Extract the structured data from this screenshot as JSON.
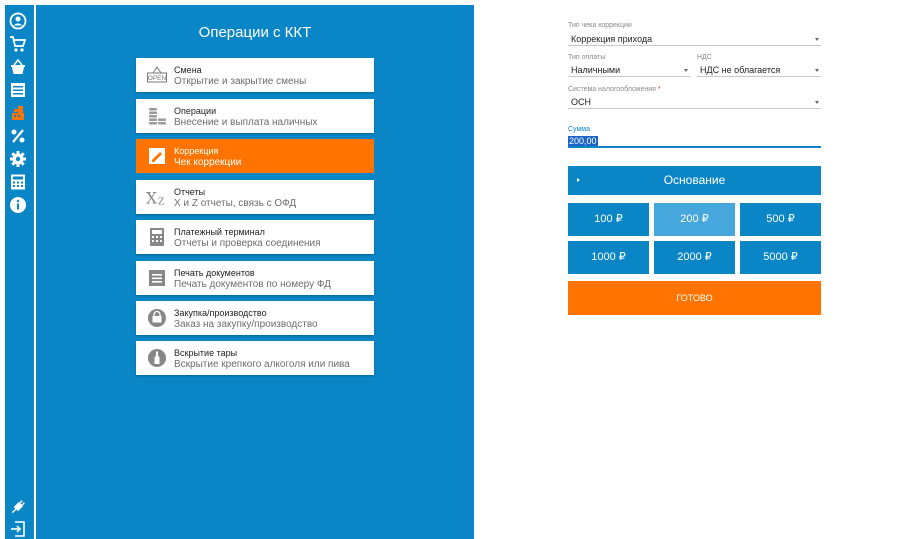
{
  "sidebar": {
    "icons": [
      "user-circle-icon",
      "cart-icon",
      "basket-icon",
      "list-icon",
      "cash-register-icon",
      "percent-icon",
      "gear-icon",
      "calculator-icon",
      "info-icon",
      "plug-icon",
      "logout-icon"
    ],
    "active_icon": "cash-register-icon"
  },
  "panel": {
    "title": "Операции с ККТ",
    "items": [
      {
        "title": "Смена",
        "subtitle": "Открытие и закрытие смены",
        "icon": "open-sign-icon"
      },
      {
        "title": "Операции",
        "subtitle": "Внесение и выплата наличных",
        "icon": "coins-icon"
      },
      {
        "title": "Коррекция",
        "subtitle": "Чек коррекции",
        "icon": "correction-icon",
        "active": true
      },
      {
        "title": "Отчеты",
        "subtitle": "X и Z отчеты, связь с ОФД",
        "icon": "xz-icon"
      },
      {
        "title": "Платежный терминал",
        "subtitle": "Отчеты и проверка соединения",
        "icon": "terminal-icon"
      },
      {
        "title": "Печать документов",
        "subtitle": "Печать документов по номеру ФД",
        "icon": "document-icon"
      },
      {
        "title": "Закупка/производство",
        "subtitle": "Заказ на закупку/производство",
        "icon": "bag-icon"
      },
      {
        "title": "Вскрытие тары",
        "subtitle": "Вскрытие крепкого алкоголя или пива",
        "icon": "bottle-icon"
      }
    ]
  },
  "form": {
    "receipt_type": {
      "label": "Тип чека коррекции",
      "value": "Коррекция прихода"
    },
    "payment_type": {
      "label": "Тип оплаты",
      "value": "Наличными"
    },
    "vat": {
      "label": "НДС",
      "value": "НДС не облагается"
    },
    "tax_system": {
      "label": "Система налогообложения",
      "required_mark": "*",
      "value": "ОСН"
    },
    "sum": {
      "label": "Сумма",
      "value": "200,00"
    },
    "basis_button": "Основание",
    "amounts": [
      "100 ₽",
      "200 ₽",
      "500 ₽",
      "1000 ₽",
      "2000 ₽",
      "5000 ₽"
    ],
    "selected_amount": "200 ₽",
    "done_button": "ГОТОВО"
  },
  "colors": {
    "primary": "#0a86c7",
    "accent": "#ff7400",
    "selected_amount": "#45a7db"
  }
}
